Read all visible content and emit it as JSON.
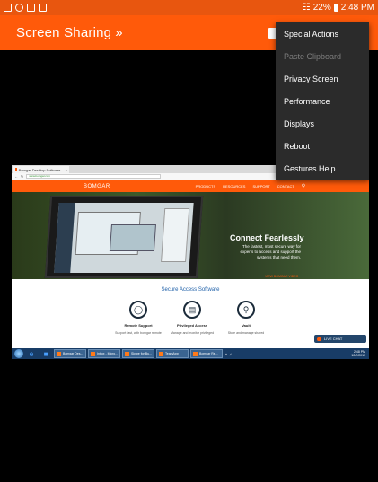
{
  "status_bar": {
    "battery": "22%",
    "time": "2:48 PM"
  },
  "app_bar": {
    "title": "Screen Sharing",
    "title_chevron": "»"
  },
  "menu": {
    "items": [
      {
        "label": "Special Actions",
        "enabled": true
      },
      {
        "label": "Paste Clipboard",
        "enabled": false
      },
      {
        "label": "Privacy Screen",
        "enabled": true
      },
      {
        "label": "Performance",
        "enabled": true
      },
      {
        "label": "Displays",
        "enabled": true
      },
      {
        "label": "Reboot",
        "enabled": true
      },
      {
        "label": "Gestures Help",
        "enabled": true
      }
    ]
  },
  "remote": {
    "browser": {
      "tab_title": "Bomgar Desktop Software...",
      "tab_close": "×",
      "address": "www.bomgar.com",
      "search_placeholder": "Search"
    },
    "site": {
      "logo": "BOMGAR",
      "nav": [
        "PRODUCTS",
        "RESOURCES",
        "SUPPORT",
        "CONTACT"
      ],
      "hero_heading": "Connect Fearlessly",
      "hero_text": "The fastest, most secure way for experts to access and support the systems that need them.",
      "hero_link": "VIEW BOMGAR VIDEO",
      "section_title": "Secure Access Software",
      "features": [
        {
          "label": "Remote Support",
          "text": "Support fast, with bomgar remote",
          "icon": "headset-icon"
        },
        {
          "label": "Privileged Access",
          "text": "Manage and monitor privileged",
          "icon": "id-card-icon"
        },
        {
          "label": "Vault",
          "text": "Store and manage shared",
          "icon": "key-icon"
        }
      ],
      "chat_label": "LIVE CHAT"
    },
    "taskbar": {
      "buttons": [
        "Bomgar Des...",
        "Inbox - Micro...",
        "Skype for Bu...",
        "TeamApp",
        "Bomgar Re..."
      ],
      "clock_time": "2:48 PM",
      "clock_date": "12/7/2017"
    }
  },
  "colors": {
    "accent": "#ff5a0a",
    "status_bar": "#e8560f",
    "menu_bg": "#2b2b2b",
    "menu_disabled": "#7d7d7d"
  }
}
